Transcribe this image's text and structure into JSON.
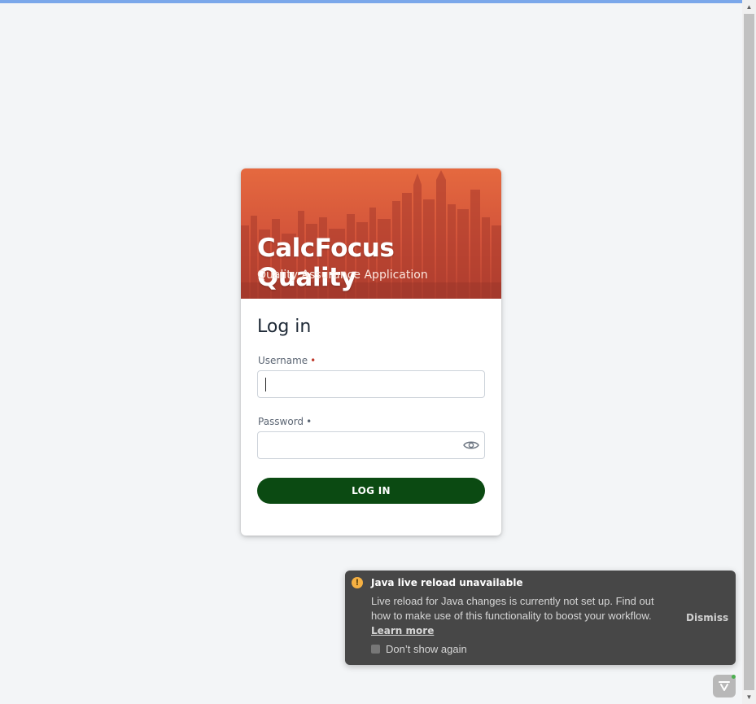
{
  "app": {
    "title": "CalcFocus Quality",
    "subtitle": "Quality Assurance Application"
  },
  "login": {
    "heading": "Log in",
    "username_label": "Username",
    "username_required": "•",
    "username_value": "",
    "password_label": "Password",
    "password_required": "•",
    "password_value": "",
    "submit_label": "LOG IN",
    "show_password_icon": "eye-icon"
  },
  "toast": {
    "title": "Java live reload unavailable",
    "body": "Live reload for Java changes is currently not set up. Find out how to make use of this functionality to boost your workflow.",
    "link": "Learn more",
    "dismiss_label": "Dismiss",
    "checkbox_label": "Don’t show again",
    "checkbox_checked": false,
    "icon": "warning-icon"
  },
  "colors": {
    "banner": "#d9583b",
    "primary_button": "#0b4a12",
    "toast_bg": "#474747",
    "page_bg": "#f3f5f7"
  }
}
